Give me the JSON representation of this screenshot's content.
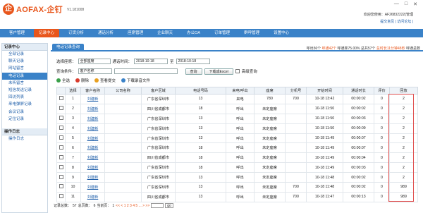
{
  "app": {
    "logo_mark": "企",
    "name": "AOFAX-企钉",
    "version": "V1.181008",
    "welcome": "欢迎您使用：AF26832222(管理",
    "links": "提交意见 | 访问论坛 |"
  },
  "menu": [
    "客户管理",
    "记录中心",
    "订货分析",
    "通话分析",
    "座席管理",
    "企业聊天",
    "办公OA",
    "订单管理",
    "群呼管理",
    "设置中心"
  ],
  "active_menu": 1,
  "sidebar": {
    "groups": [
      {
        "title": "记录中心",
        "items": [
          "全部记录",
          "聊天记录",
          "网站留言",
          "电话记录",
          "未听留言",
          "短信发送记录",
          "回访列表",
          "来电弹屏记录",
          "会议记录",
          "定位记录"
        ]
      },
      {
        "title": "操作日志",
        "items": [
          "操作日志"
        ]
      }
    ],
    "active": "电话记录"
  },
  "tab": "电话记录查询",
  "stats": {
    "a": "呼出56个",
    "b": "呼通42个",
    "c": "呼通率75.00%",
    "d": "总共57个",
    "e": "总时长11分钟48秒",
    "f": "呼通总数"
  },
  "filters": {
    "seat_label": "选择座席：",
    "seat_value": "全部座席",
    "time_label": "通话时间：",
    "from": "2018-10-18",
    "to_label": "至",
    "to": "2018-10-18",
    "cond_label": "查询条件：",
    "cond_value": "客户名称",
    "search": "查询",
    "download": "下载成Excel",
    "advanced": "高级查询"
  },
  "actions": [
    "全选",
    "删除",
    "查看提交",
    "下载录音文件"
  ],
  "columns": [
    "",
    "选择",
    "客户名称",
    "公司名称",
    "客户区域",
    "电话号码",
    "来电/呼出",
    "座席",
    "分机号",
    "开始时间",
    "通话时长",
    "评价",
    "回放"
  ],
  "rows": [
    [
      "1",
      "刘建新",
      "",
      "广东省深圳市",
      "13",
      "来电",
      "780",
      "700",
      "10-18 13:42",
      "00:00:02",
      "0",
      "2"
    ],
    [
      "2",
      "刘建新",
      "",
      "四川省成都市",
      "18",
      "呼出",
      "未定座席",
      "",
      "10-18 11:50",
      "00:00:02",
      "0",
      "2"
    ],
    [
      "3",
      "刘建新",
      "",
      "广东省深圳市",
      "13",
      "呼出",
      "未定座席",
      "",
      "10-18 11:50",
      "00:00:03",
      "0",
      "2"
    ],
    [
      "4",
      "刘建新",
      "",
      "广东省深圳市",
      "13",
      "呼出",
      "未定座席",
      "",
      "10-18 11:50",
      "00:00:09",
      "0",
      "2"
    ],
    [
      "5",
      "刘建新",
      "",
      "广东省深圳市",
      "13",
      "呼出",
      "未定座席",
      "",
      "10-18 11:49",
      "00:00:07",
      "0",
      "2"
    ],
    [
      "6",
      "刘建新",
      "",
      "广东省深圳市",
      "18",
      "呼出",
      "未定座席",
      "",
      "10-18 11:49",
      "00:00:07",
      "0",
      "2"
    ],
    [
      "7",
      "刘建新",
      "",
      "四川省成都市",
      "18",
      "呼出",
      "未定座席",
      "",
      "10-18 11:49",
      "00:00:04",
      "0",
      "2"
    ],
    [
      "8",
      "刘建新",
      "",
      "广东省深圳市",
      "18",
      "呼出",
      "未定座席",
      "",
      "10-18 11:49",
      "00:00:03",
      "0",
      "2"
    ],
    [
      "9",
      "刘建新",
      "",
      "广东省深圳市",
      "13",
      "呼出",
      "未定座席",
      "",
      "10-18 11:48",
      "00:00:02",
      "0",
      "2"
    ],
    [
      "10",
      "刘建新",
      "",
      "广东省深圳市",
      "13",
      "呼出",
      "未定座席",
      "700",
      "10-18 11:48",
      "00:00:02",
      "0",
      "989"
    ],
    [
      "11",
      "刘建新",
      "",
      "四川省成都市",
      "13",
      "呼出",
      "未定座席",
      "700",
      "10-18 11:47",
      "00:00:13",
      "0",
      "989"
    ]
  ],
  "pager": {
    "total_label": "记录总数：",
    "total": "57",
    "pages_label": "总页数：",
    "pages": "6",
    "cur_label": "当前页：",
    "cur": "1",
    "links": "<< < 1 2 3 4 5 ... > >>",
    "go": "go"
  }
}
